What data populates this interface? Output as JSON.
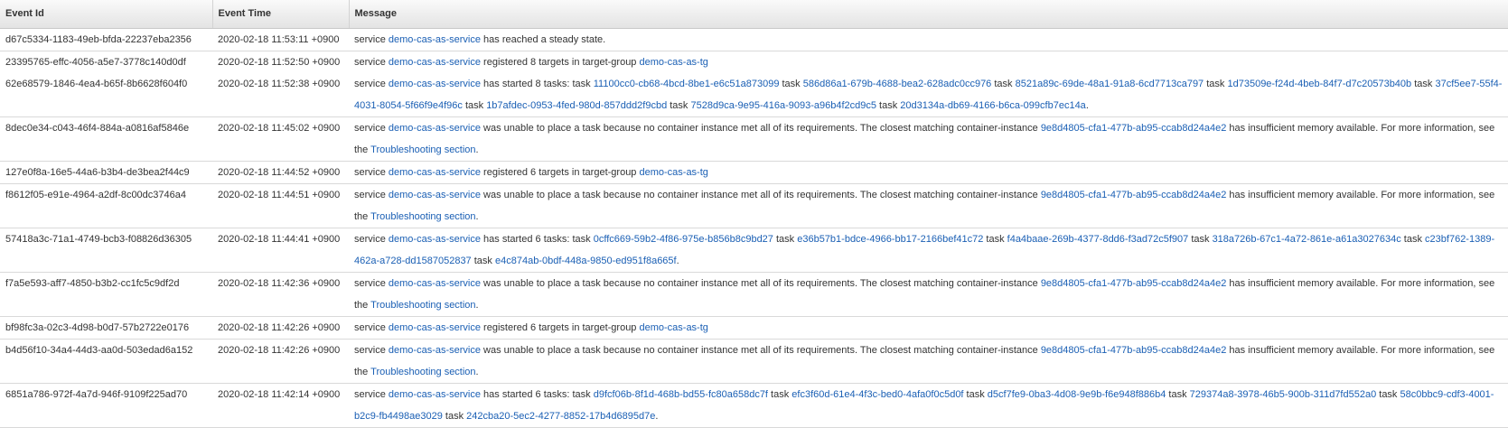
{
  "headers": {
    "event_id": "Event Id",
    "event_time": "Event Time",
    "message": "Message"
  },
  "rows": [
    {
      "id": "d67c5334-1183-49eb-bfda-22237eba2356",
      "time": "2020-02-18 11:53:11 +0900",
      "sep": true,
      "parts": [
        [
          "t",
          "service "
        ],
        [
          "l",
          "demo-cas-as-service"
        ],
        [
          "t",
          " has reached a steady state."
        ]
      ]
    },
    {
      "id": "23395765-effc-4056-a5e7-3778c140d0df",
      "time": "2020-02-18 11:52:50 +0900",
      "sep": false,
      "parts": [
        [
          "t",
          "service "
        ],
        [
          "l",
          "demo-cas-as-service"
        ],
        [
          "t",
          " registered 8 targets in target-group "
        ],
        [
          "l",
          "demo-cas-as-tg"
        ]
      ]
    },
    {
      "id": "62e68579-1846-4ea4-b65f-8b6628f604f0",
      "time": "2020-02-18 11:52:38 +0900",
      "sep": true,
      "parts": [
        [
          "t",
          "service "
        ],
        [
          "l",
          "demo-cas-as-service"
        ],
        [
          "t",
          " has started 8 tasks: task "
        ],
        [
          "l",
          "11100cc0-cb68-4bcd-8be1-e6c51a873099"
        ],
        [
          "t",
          " task "
        ],
        [
          "l",
          "586d86a1-679b-4688-bea2-628adc0cc976"
        ],
        [
          "t",
          " task "
        ],
        [
          "l",
          "8521a89c-69de-48a1-91a8-6cd7713ca797"
        ],
        [
          "t",
          " task "
        ],
        [
          "l",
          "1d73509e-f24d-4beb-84f7-d7c20573b40b"
        ],
        [
          "t",
          " task "
        ],
        [
          "l",
          "37cf5ee7-55f4-4031-8054-5f66f9e4f96c"
        ],
        [
          "t",
          " task "
        ],
        [
          "l",
          "1b7afdec-0953-4fed-980d-857ddd2f9cbd"
        ],
        [
          "t",
          " task "
        ],
        [
          "l",
          "7528d9ca-9e95-416a-9093-a96b4f2cd9c5"
        ],
        [
          "t",
          " task "
        ],
        [
          "l",
          "20d3134a-db69-4166-b6ca-099cfb7ec14a"
        ],
        [
          "t",
          "."
        ]
      ]
    },
    {
      "id": "8dec0e34-c043-46f4-884a-a0816af5846e",
      "time": "2020-02-18 11:45:02 +0900",
      "sep": true,
      "parts": [
        [
          "t",
          "service "
        ],
        [
          "l",
          "demo-cas-as-service"
        ],
        [
          "t",
          " was unable to place a task because no container instance met all of its requirements. The closest matching container-instance "
        ],
        [
          "l",
          "9e8d4805-cfa1-477b-ab95-ccab8d24a4e2"
        ],
        [
          "t",
          " has insufficient memory available. For more information, see the "
        ],
        [
          "l",
          "Troubleshooting section"
        ],
        [
          "t",
          "."
        ]
      ]
    },
    {
      "id": "127e0f8a-16e5-44a6-b3b4-de3bea2f44c9",
      "time": "2020-02-18 11:44:52 +0900",
      "sep": true,
      "parts": [
        [
          "t",
          "service "
        ],
        [
          "l",
          "demo-cas-as-service"
        ],
        [
          "t",
          " registered 6 targets in target-group "
        ],
        [
          "l",
          "demo-cas-as-tg"
        ]
      ]
    },
    {
      "id": "f8612f05-e91e-4964-a2df-8c00dc3746a4",
      "time": "2020-02-18 11:44:51 +0900",
      "sep": true,
      "parts": [
        [
          "t",
          "service "
        ],
        [
          "l",
          "demo-cas-as-service"
        ],
        [
          "t",
          " was unable to place a task because no container instance met all of its requirements. The closest matching container-instance "
        ],
        [
          "l",
          "9e8d4805-cfa1-477b-ab95-ccab8d24a4e2"
        ],
        [
          "t",
          " has insufficient memory available. For more information, see the "
        ],
        [
          "l",
          "Troubleshooting section"
        ],
        [
          "t",
          "."
        ]
      ]
    },
    {
      "id": "57418a3c-71a1-4749-bcb3-f08826d36305",
      "time": "2020-02-18 11:44:41 +0900",
      "sep": true,
      "parts": [
        [
          "t",
          "service "
        ],
        [
          "l",
          "demo-cas-as-service"
        ],
        [
          "t",
          " has started 6 tasks: task "
        ],
        [
          "l",
          "0cffc669-59b2-4f86-975e-b856b8c9bd27"
        ],
        [
          "t",
          " task "
        ],
        [
          "l",
          "e36b57b1-bdce-4966-bb17-2166bef41c72"
        ],
        [
          "t",
          " task "
        ],
        [
          "l",
          "f4a4baae-269b-4377-8dd6-f3ad72c5f907"
        ],
        [
          "t",
          " task "
        ],
        [
          "l",
          "318a726b-67c1-4a72-861e-a61a3027634c"
        ],
        [
          "t",
          " task "
        ],
        [
          "l",
          "c23bf762-1389-462a-a728-dd1587052837"
        ],
        [
          "t",
          " task "
        ],
        [
          "l",
          "e4c874ab-0bdf-448a-9850-ed951f8a665f"
        ],
        [
          "t",
          "."
        ]
      ]
    },
    {
      "id": "f7a5e593-aff7-4850-b3b2-cc1fc5c9df2d",
      "time": "2020-02-18 11:42:36 +0900",
      "sep": true,
      "parts": [
        [
          "t",
          "service "
        ],
        [
          "l",
          "demo-cas-as-service"
        ],
        [
          "t",
          " was unable to place a task because no container instance met all of its requirements. The closest matching container-instance "
        ],
        [
          "l",
          "9e8d4805-cfa1-477b-ab95-ccab8d24a4e2"
        ],
        [
          "t",
          " has insufficient memory available. For more information, see the "
        ],
        [
          "l",
          "Troubleshooting section"
        ],
        [
          "t",
          "."
        ]
      ]
    },
    {
      "id": "bf98fc3a-02c3-4d98-b0d7-57b2722e0176",
      "time": "2020-02-18 11:42:26 +0900",
      "sep": true,
      "parts": [
        [
          "t",
          "service "
        ],
        [
          "l",
          "demo-cas-as-service"
        ],
        [
          "t",
          " registered 6 targets in target-group "
        ],
        [
          "l",
          "demo-cas-as-tg"
        ]
      ]
    },
    {
      "id": "b4d56f10-34a4-44d3-aa0d-503edad6a152",
      "time": "2020-02-18 11:42:26 +0900",
      "sep": true,
      "parts": [
        [
          "t",
          "service "
        ],
        [
          "l",
          "demo-cas-as-service"
        ],
        [
          "t",
          " was unable to place a task because no container instance met all of its requirements. The closest matching container-instance "
        ],
        [
          "l",
          "9e8d4805-cfa1-477b-ab95-ccab8d24a4e2"
        ],
        [
          "t",
          " has insufficient memory available. For more information, see the "
        ],
        [
          "l",
          "Troubleshooting section"
        ],
        [
          "t",
          "."
        ]
      ]
    },
    {
      "id": "6851a786-972f-4a7d-946f-9109f225ad70",
      "time": "2020-02-18 11:42:14 +0900",
      "sep": true,
      "parts": [
        [
          "t",
          "service "
        ],
        [
          "l",
          "demo-cas-as-service"
        ],
        [
          "t",
          " has started 6 tasks: task "
        ],
        [
          "l",
          "d9fcf06b-8f1d-468b-bd55-fc80a658dc7f"
        ],
        [
          "t",
          " task "
        ],
        [
          "l",
          "efc3f60d-61e4-4f3c-bed0-4afa0f0c5d0f"
        ],
        [
          "t",
          " task "
        ],
        [
          "l",
          "d5cf7fe9-0ba3-4d08-9e9b-f6e948f886b4"
        ],
        [
          "t",
          " task "
        ],
        [
          "l",
          "729374a8-3978-46b5-900b-311d7fd552a0"
        ],
        [
          "t",
          " task "
        ],
        [
          "l",
          "58c0bbc9-cdf3-4001-b2c9-fb4498ae3029"
        ],
        [
          "t",
          " task "
        ],
        [
          "l",
          "242cba20-5ec2-4277-8852-17b4d6895d7e"
        ],
        [
          "t",
          "."
        ]
      ]
    }
  ]
}
